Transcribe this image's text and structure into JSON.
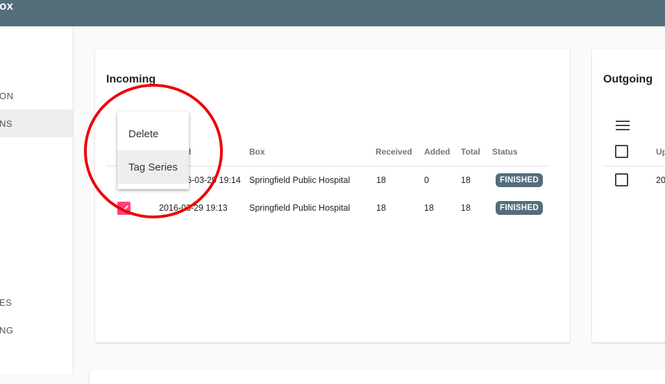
{
  "app": {
    "title": "ox"
  },
  "sidebar": {
    "items": [
      {
        "label": "ON",
        "active": false
      },
      {
        "label": "NS",
        "active": true
      },
      {
        "label": "ES",
        "active": false
      },
      {
        "label": "NG",
        "active": false
      }
    ]
  },
  "incoming": {
    "title": "Incoming",
    "columns": [
      "d",
      "Box",
      "Received",
      "Added",
      "Total",
      "Status"
    ],
    "rows": [
      {
        "created": "6-03-29 19:14",
        "box": "Springfield Public Hospital",
        "received": "18",
        "added": "0",
        "total": "18",
        "status": "FINISHED"
      },
      {
        "created": "2016-03-29 19:13",
        "box": "Springfield Public Hospital",
        "received": "18",
        "added": "18",
        "total": "18",
        "status": "FINISHED"
      }
    ]
  },
  "context_menu": {
    "items": [
      "Delete",
      "Tag Series"
    ]
  },
  "outgoing": {
    "title": "Outgoing",
    "columns": [
      "Up"
    ],
    "rows": [
      {
        "cell": "20"
      }
    ]
  },
  "colors": {
    "topbar": "#546e7a",
    "badge": "#546e7a",
    "checkbox_checked": "#ff4081",
    "highlight_circle": "#ee0000"
  }
}
